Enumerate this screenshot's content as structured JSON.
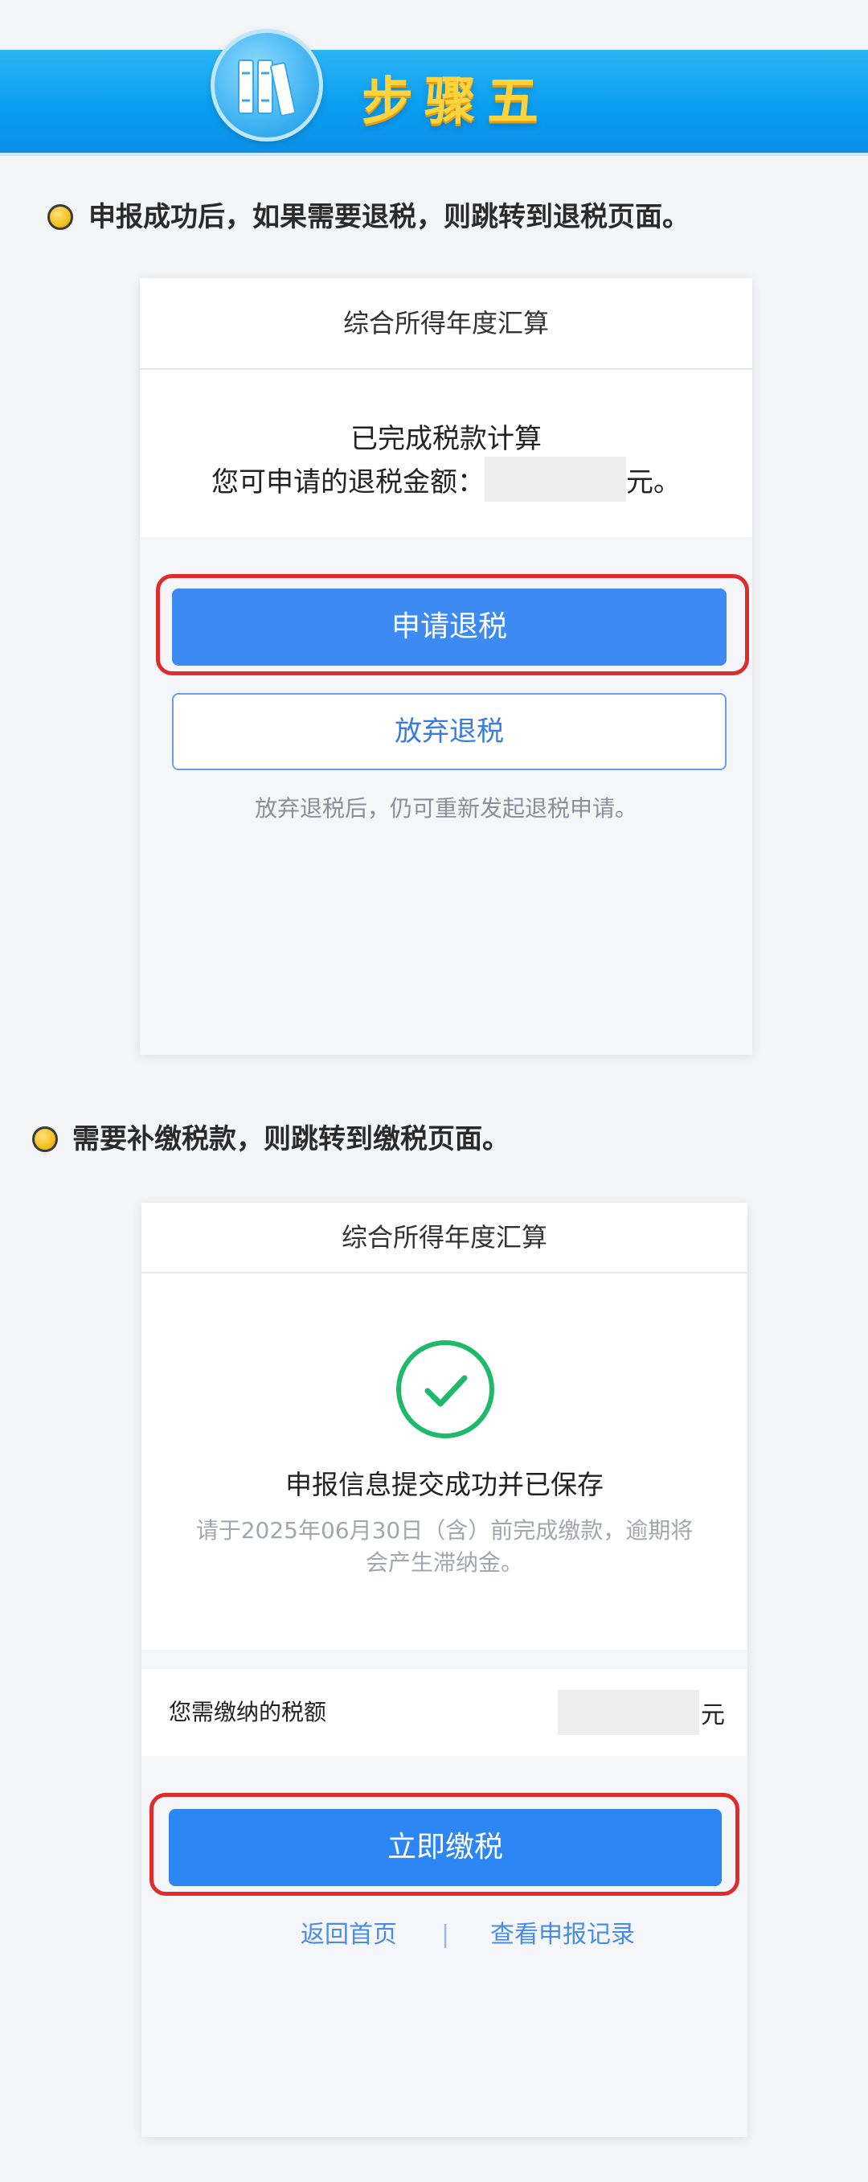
{
  "banner": {
    "title": "步骤五"
  },
  "section1": {
    "heading": "申报成功后，如果需要退税，则跳转到退税页面。"
  },
  "refund_screen": {
    "header_title": "综合所得年度汇算",
    "status_line": "已完成税款计算",
    "amount_label": "您可申请的退税金额：",
    "amount_unit": "元。",
    "apply_button": "申请退税",
    "give_up_button": "放弃退税",
    "hint": "放弃退税后，仍可重新发起退税申请。"
  },
  "section2": {
    "heading": "需要补缴税款，则跳转到缴税页面。"
  },
  "payment_screen": {
    "header_title": "综合所得年度汇算",
    "success_title": "申报信息提交成功并已保存",
    "deadline_note": "请于2025年06月30日（含）前完成缴款，逾期将会产生滞纳金。",
    "tax_label": "您需缴纳的税额",
    "tax_unit": "元",
    "pay_button": "立即缴税",
    "link_home": "返回首页",
    "link_separator": "|",
    "link_records": "查看申报记录"
  },
  "colors": {
    "banner_blue": "#0a9ef0",
    "title_yellow": "#ffd33b",
    "primary_button": "#3d8af2",
    "highlight_red": "#e02b2b",
    "success_green": "#1fb96b",
    "link_blue": "#4a8de0"
  },
  "icons": {
    "banner_badge": "books-icon",
    "bullet": "yellow-dot-icon",
    "success": "check-circle-icon"
  }
}
